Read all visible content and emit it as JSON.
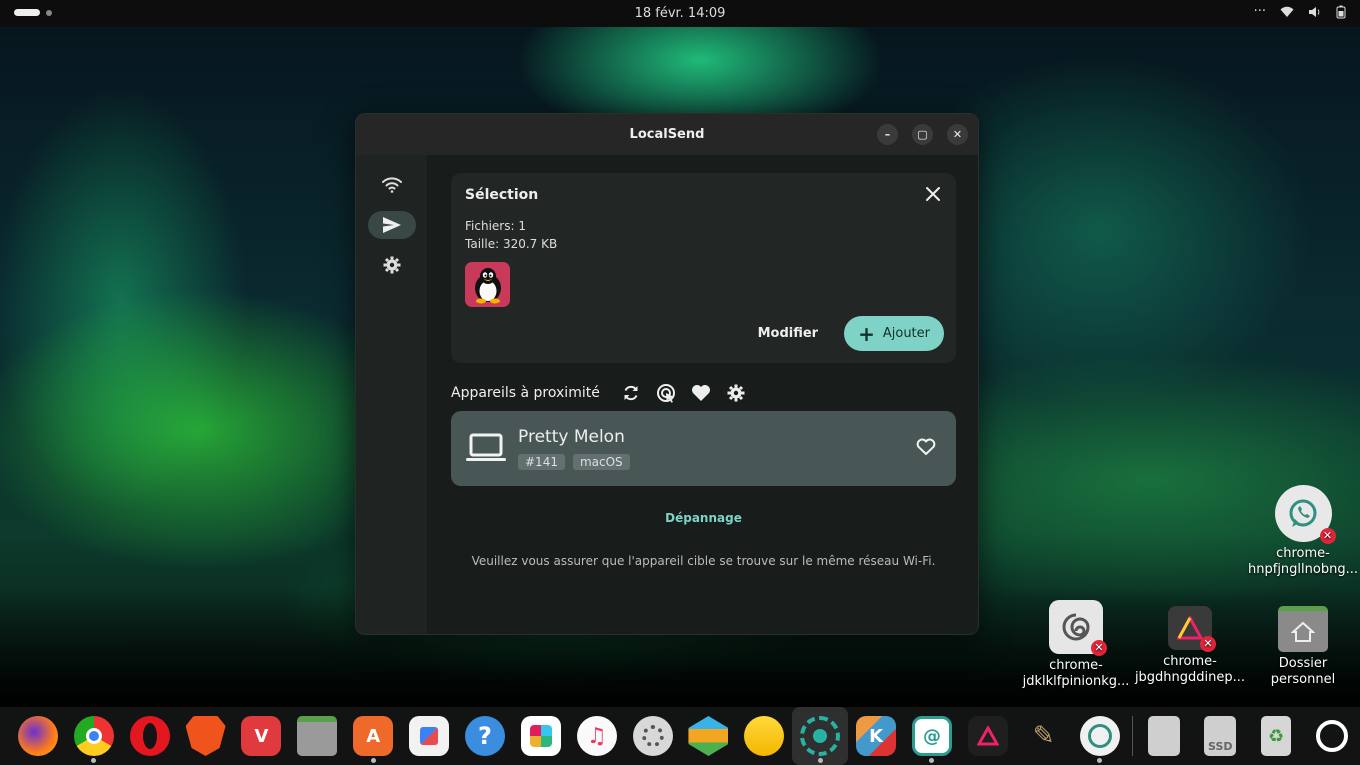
{
  "topbar": {
    "datetime": "18 févr.  14:09",
    "tray_more": "···"
  },
  "window": {
    "title": "LocalSend",
    "controls": {
      "minimize": "–",
      "maximize": "▢",
      "close": "✕"
    }
  },
  "sidebar": {
    "items": [
      {
        "name": "wifi-icon"
      },
      {
        "name": "send-icon",
        "active": true
      },
      {
        "name": "gear-icon"
      }
    ]
  },
  "selection": {
    "title": "Sélection",
    "files": "Fichiers: 1",
    "size": "Taille: 320.7 KB",
    "modify_label": "Modifier",
    "add_label": "Ajouter"
  },
  "nearby": {
    "title": "Appareils à proximité",
    "device": {
      "name": "Pretty Melon",
      "tags": [
        "#141",
        "macOS"
      ]
    },
    "troubleshoot": "Dépannage",
    "hint": "Veuillez vous assurer que l'appareil cible se trouve sur le même réseau Wi-Fi."
  },
  "desktop_icons": [
    {
      "line1": "chrome-",
      "line2": "hnpfjngllnobng..."
    },
    {
      "line1": "chrome-",
      "line2": "jdklklfpinionkg..."
    },
    {
      "line1": "chrome-",
      "line2": "jbgdhngddinep..."
    },
    {
      "line1": "Dossier",
      "line2": "personnel"
    }
  ],
  "dock": {
    "ssd_label": "SSD",
    "help_glyph": "?"
  },
  "colors": {
    "accent": "#7fd3c6",
    "device_card": "#485755",
    "error_badge": "#e0243a"
  }
}
